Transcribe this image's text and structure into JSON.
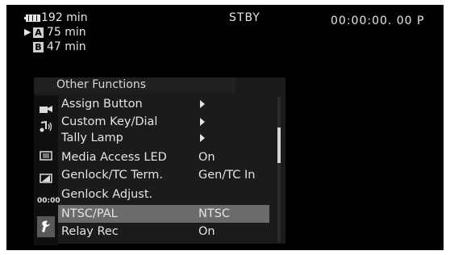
{
  "status": {
    "battery": "192 min",
    "slot_a_marker": "▶",
    "slot_a_label": "A",
    "slot_a_time": "75 min",
    "slot_b_label": "B",
    "slot_b_time": "47 min",
    "mode": "STBY",
    "timecode": "00:00:00. 00 P"
  },
  "menu": {
    "title": "Other Functions",
    "items": [
      {
        "label": "Assign Button",
        "value": "",
        "submenu": true
      },
      {
        "label": "Custom Key/Dial",
        "value": "",
        "submenu": true
      },
      {
        "label": "Tally Lamp",
        "value": "",
        "submenu": true
      },
      {
        "label": "Media Access LED",
        "value": "On",
        "submenu": false
      },
      {
        "label": "Genlock/TC Term.",
        "value": "Gen/TC In",
        "submenu": false
      },
      {
        "label": "Genlock Adjust.",
        "value": "",
        "submenu": false
      },
      {
        "label": "NTSC/PAL",
        "value": "NTSC",
        "submenu": false
      },
      {
        "label": "Relay Rec",
        "value": "On",
        "submenu": false
      }
    ],
    "side_icons": [
      {
        "name": "camera-icon"
      },
      {
        "name": "audio-icon"
      },
      {
        "name": "video-setup-icon"
      },
      {
        "name": "display-setup-icon"
      },
      {
        "name": "timecode-icon",
        "text": "00:00"
      },
      {
        "name": "wrench-icon"
      }
    ]
  },
  "colors": {
    "screen_bg": "#000000",
    "selected_row": "#6b6b6b",
    "text": "#e4e4e4"
  }
}
